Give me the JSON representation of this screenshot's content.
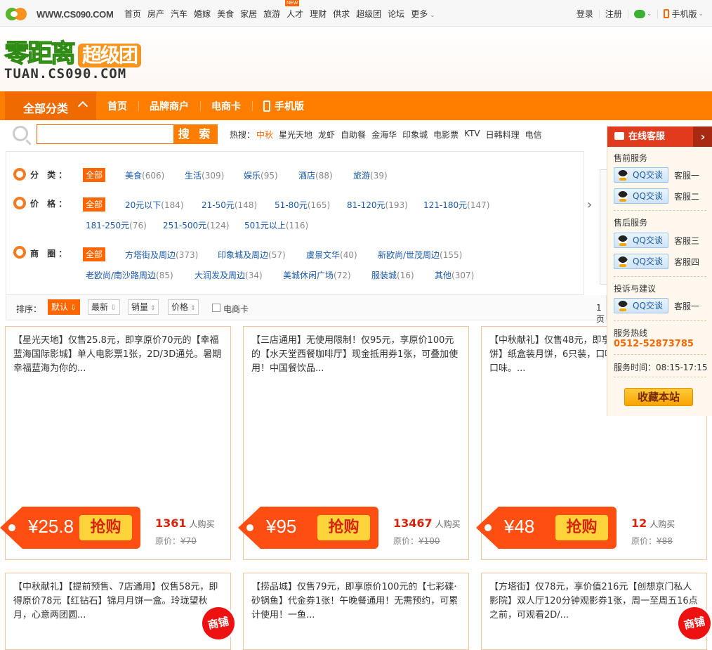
{
  "topbar": {
    "logo_url": "WWW.CS090.COM",
    "nav": [
      "首页",
      "房产",
      "汽车",
      "婚嫁",
      "美食",
      "家居",
      "旅游",
      "人才",
      "理财",
      "供求",
      "超级团",
      "论坛",
      "更多"
    ],
    "new_badge": "NEW",
    "login": "登录",
    "register": "注册",
    "mobile": "手机版"
  },
  "header": {
    "logo_cn1": "零距离",
    "logo_cn2": "超级团",
    "logo_en": "TUAN.CS090.COM"
  },
  "mainnav": {
    "all_categories": "全部分类",
    "items": [
      "首页",
      "品牌商户",
      "电商卡",
      "手机版"
    ]
  },
  "search": {
    "button": "搜 索",
    "hot_label": "热搜：",
    "hot": [
      "中秋",
      "星光天地",
      "龙虾",
      "自助餐",
      "金海华",
      "印象城",
      "电影票",
      "KTV",
      "日韩料理",
      "电信"
    ]
  },
  "filters": {
    "category": {
      "label": "分 类：",
      "all": "全部",
      "options": [
        [
          "美食",
          "(606)"
        ],
        [
          "生活",
          "(309)"
        ],
        [
          "娱乐",
          "(95)"
        ],
        [
          "酒店",
          "(88)"
        ],
        [
          "旅游",
          "(39)"
        ]
      ]
    },
    "price": {
      "label": "价 格：",
      "all": "全部",
      "options": [
        [
          "20元以下",
          "(184)"
        ],
        [
          "21-50元",
          "(148)"
        ],
        [
          "51-80元",
          "(165)"
        ],
        [
          "81-120元",
          "(193)"
        ],
        [
          "121-180元",
          "(147)"
        ],
        [
          "181-250元",
          "(76)"
        ],
        [
          "251-500元",
          "(124)"
        ],
        [
          "501元以上",
          "(116)"
        ]
      ]
    },
    "district": {
      "label": "商 圈：",
      "all": "全部",
      "options": [
        [
          "方塔街及周边",
          "(373)"
        ],
        [
          "印象城及周边",
          "(57)"
        ],
        [
          "虞景文华",
          "(40)"
        ],
        [
          "新欧尚/世茂周边",
          "(155)"
        ],
        [
          "老欧尚/南沙路周边",
          "(85)"
        ],
        [
          "大润发及周边",
          "(34)"
        ],
        [
          "美城休闲广场",
          "(72)"
        ],
        [
          "服装城",
          "(16)"
        ],
        [
          "其他",
          "(307)"
        ]
      ]
    }
  },
  "sort": {
    "label": "排序：",
    "buttons": [
      "默认",
      "最新",
      "销量",
      "价格"
    ],
    "card_filter": "电商卡",
    "page_info": "1页"
  },
  "deals": [
    {
      "title": "【星光天地】仅售25.8元，即享原价70元的【幸福蓝海国际影城】单人电影票1张，2D/3D通兑。暑期幸福蓝海为你的...",
      "price": "¥25.8",
      "buy": "抢购",
      "sold": "1361",
      "sold_unit": "人购买",
      "orig_label": "原价：",
      "orig": "¥70"
    },
    {
      "title": "【三店通用】无使用限制！仅95元，享原价100元的【水天堂西餐咖啡厅】现金抵用券1张，可叠加使用！中国餐饮品...",
      "price": "¥95",
      "buy": "抢购",
      "sold": "13467",
      "sold_unit": "人购买",
      "orig_label": "原价：",
      "orig": "¥100"
    },
    {
      "title": "【中秋献礼】仅售48元，即享原价88元的手工月饼】纸盒装月饼，6只装，口味包括莲蓉、蛋黄豆沙口味。...",
      "price": "¥48",
      "buy": "抢购",
      "sold": "12",
      "sold_unit": "人购买",
      "orig_label": "原价：",
      "orig": "¥88"
    },
    {
      "title": "【中秋献礼】【提前预售、7店通用】仅售58元，即得原价78元【红钻石】锦月月饼一盒。玲珑望秋月，心意两团圆...",
      "shop": "商铺"
    },
    {
      "title": "【捞品城】仅售79元，即享原价100元的【七彩碟·砂锅鱼】代金券1张！午晚餐通用！无需预约，可累计使用！一鱼..."
    },
    {
      "title": "【方塔街】仅78元，享价值216元【创想京门私人影院】双人厅120分钟观影券1张，周一至周五16点之前，可观看2D/...",
      "shop": "商铺"
    }
  ],
  "service": {
    "title": "在线客服",
    "presale": "售前服务",
    "aftersale": "售后服务",
    "complaint": "投诉与建议",
    "qq_label": "QQ交谈",
    "agents": [
      "客服一",
      "客服二",
      "客服三",
      "客服四",
      "客服一"
    ],
    "hotline_label": "服务热线",
    "hotline": "0512-52873785",
    "hours": "服务时间：08:15-17:15",
    "favorite": "收藏本站"
  }
}
